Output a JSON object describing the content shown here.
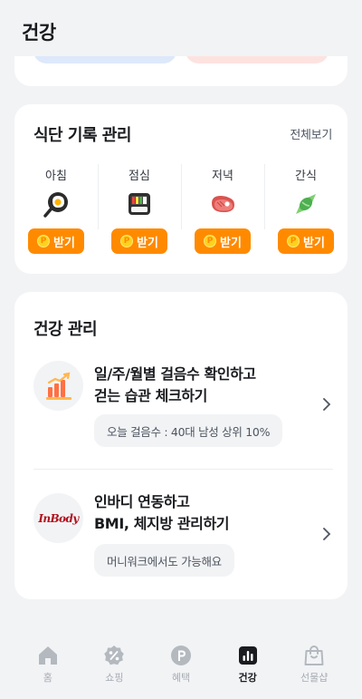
{
  "header": {
    "title": "건강"
  },
  "meal": {
    "title": "식단 기록 관리",
    "view_all": "전체보기",
    "items": [
      {
        "label": "아침",
        "icon": "fried-egg-pan-icon",
        "button": "받기"
      },
      {
        "label": "점심",
        "icon": "bento-box-icon",
        "button": "받기"
      },
      {
        "label": "저녁",
        "icon": "steak-icon",
        "button": "받기"
      },
      {
        "label": "간식",
        "icon": "candy-icon",
        "button": "받기"
      }
    ],
    "point_symbol": "P"
  },
  "health": {
    "title": "건강 관리",
    "steps": {
      "line1": "일/주/월별 걸음수 확인하고",
      "line2": "걷는 습관 체크하기",
      "chip": "오늘 걸음수 : 40대 남성 상위 10%"
    },
    "inbody": {
      "logo": "InBody",
      "line1": "인바디 연동하고",
      "line2": "BMI, 체지방 관리하기",
      "chip": "머니워크에서도 가능해요"
    }
  },
  "nav": {
    "items": [
      {
        "label": "홈",
        "icon": "home-icon"
      },
      {
        "label": "쇼핑",
        "icon": "percent-badge-icon"
      },
      {
        "label": "혜택",
        "icon": "point-coin-icon"
      },
      {
        "label": "건강",
        "icon": "bar-chart-icon",
        "active": true
      },
      {
        "label": "선물샵",
        "icon": "shopping-bag-icon"
      }
    ]
  },
  "colors": {
    "accent_orange": "#ff8a00",
    "background": "#f2f3f5",
    "inbody_red": "#b0121e"
  }
}
